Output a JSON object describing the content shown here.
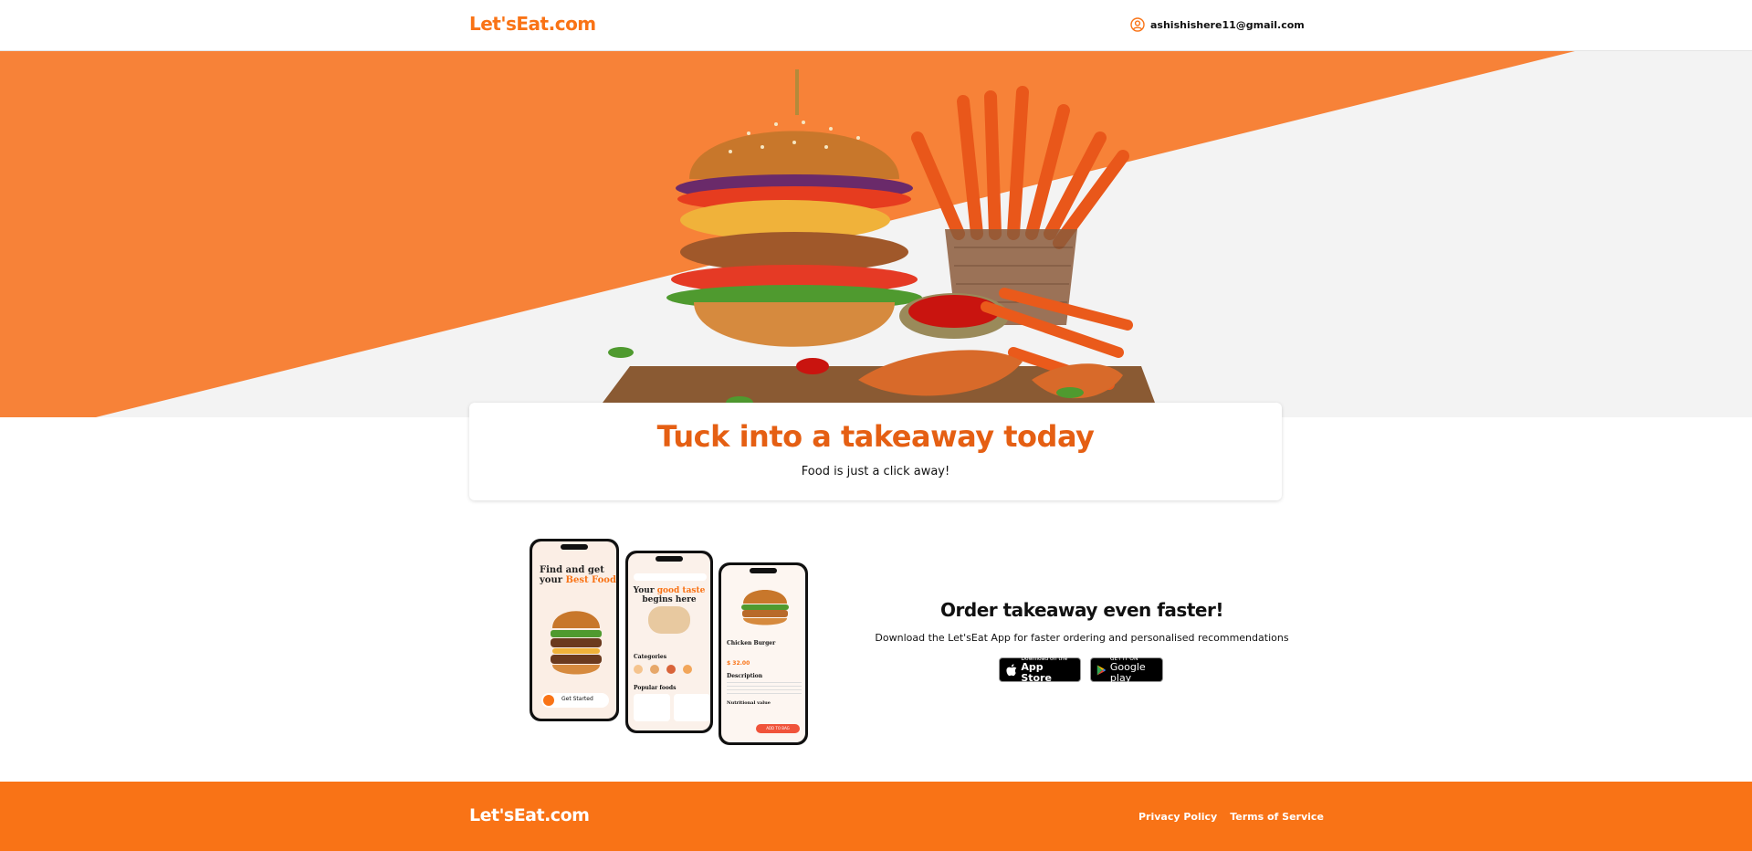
{
  "header": {
    "brand": "Let'sEat.com",
    "user_email": "ashishishere11@gmail.com"
  },
  "hero": {
    "title": "Tuck into a takeaway today",
    "subtitle": "Food is just a click away!"
  },
  "app_promo": {
    "title": "Order takeaway even faster!",
    "description": "Download the Let'sEat App for faster ordering and personalised recommendations",
    "app_store": {
      "small": "Download on the",
      "big": "App Store"
    },
    "google_play": {
      "small": "GET IT ON",
      "big": "Google play"
    },
    "phone_screens": [
      {
        "heading_line1": "Find and get",
        "heading_line2_prefix": "your ",
        "heading_highlight": "Best Food",
        "cta": "Get Started"
      },
      {
        "heading_line1": "Your ",
        "heading_highlight": "good taste",
        "heading_line2": "begins here",
        "section1": "Categories",
        "section2": "Popular foods"
      },
      {
        "item_name": "Chicken Burger",
        "price": "$ 32.00",
        "section1": "Description",
        "section2": "Nutritional value",
        "cta": "ADD TO BAG"
      }
    ]
  },
  "footer": {
    "brand": "Let'sEat.com",
    "links": [
      "Privacy Policy",
      "Terms of Service"
    ]
  },
  "colors": {
    "accent": "#f97316",
    "accent_dark": "#e55f13",
    "hero_gray": "#f3f3f3"
  }
}
